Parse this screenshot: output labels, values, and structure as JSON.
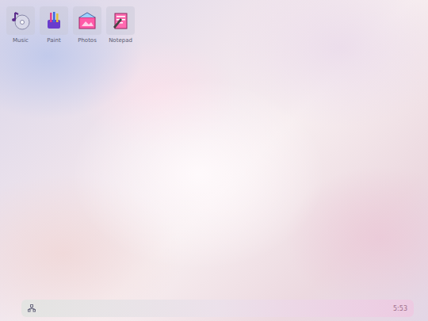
{
  "desktop": {
    "icons": [
      {
        "label": "Music"
      },
      {
        "label": "Paint"
      },
      {
        "label": "Photos"
      },
      {
        "label": "Notepad"
      }
    ]
  },
  "taskbar": {
    "clock": "5:53"
  }
}
